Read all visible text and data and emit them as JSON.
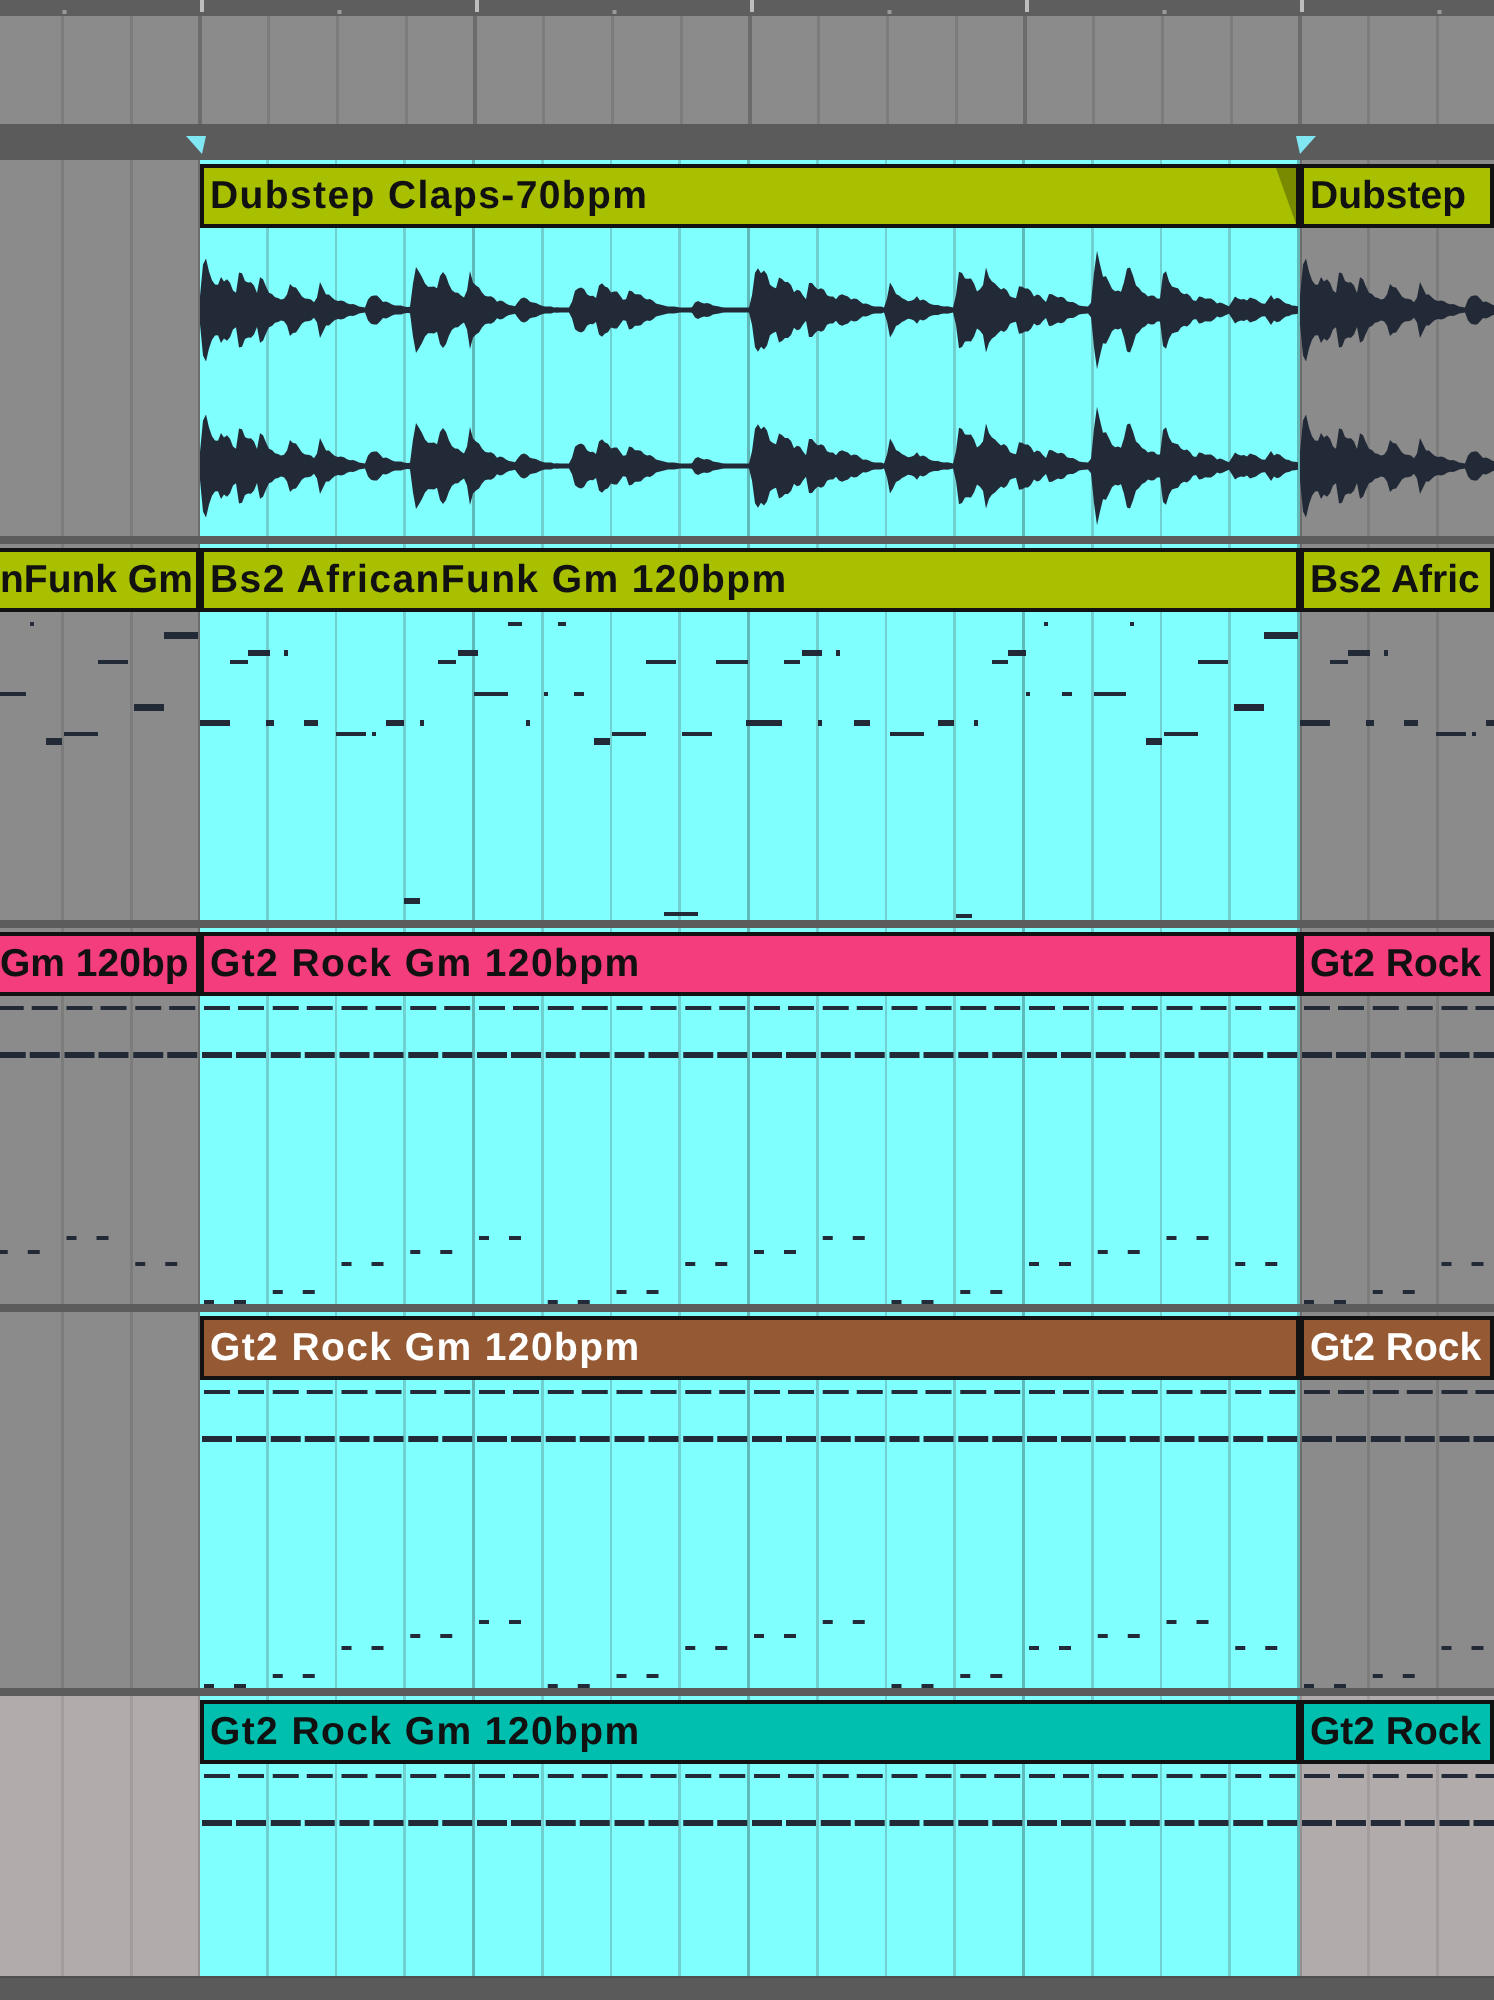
{
  "tracks": [
    {
      "selected": false
    },
    {
      "kind": "audio",
      "selected": false,
      "clips": [
        {
          "kind": "whole",
          "name": "Dubstep Claps-70bpm",
          "color": "#a8c000",
          "selected": true
        },
        {
          "kind": "head",
          "name": "Dubstep",
          "color": "#a8c000",
          "selected": false
        }
      ]
    },
    {
      "kind": "midi",
      "selected": false,
      "clips": [
        {
          "kind": "tail",
          "name": "nFunk Gm",
          "color": "#a8c000",
          "selected": false
        },
        {
          "kind": "whole",
          "name": "Bs2 AfricanFunk Gm 120bpm",
          "color": "#a8c000",
          "selected": true
        },
        {
          "kind": "head",
          "name": "Bs2 Afric",
          "color": "#a8c000",
          "selected": false
        }
      ]
    },
    {
      "kind": "midi",
      "selected": false,
      "clips": [
        {
          "kind": "tail",
          "name": "Gm 120bp",
          "color": "#f33d7d",
          "selected": false
        },
        {
          "kind": "whole",
          "name": "Gt2 Rock Gm 120bpm",
          "color": "#f33d7d",
          "selected": true
        },
        {
          "kind": "head",
          "name": "Gt2 Rock",
          "color": "#f33d7d",
          "selected": false
        }
      ]
    },
    {
      "kind": "midi",
      "selected": false,
      "clips": [
        {
          "kind": "whole",
          "name": "Gt2 Rock Gm 120bpm",
          "color": "#955a34",
          "selected": true
        },
        {
          "kind": "head",
          "name": "Gt2 Rock",
          "color": "#955a34",
          "selected": false
        }
      ]
    },
    {
      "kind": "midi",
      "selected": true,
      "clips": [
        {
          "kind": "whole",
          "name": "Gt2 Rock Gm 120bpm",
          "color": "#00bfae",
          "selected": true
        },
        {
          "kind": "head",
          "name": "Gt2 Rock",
          "color": "#00bfae",
          "selected": false
        }
      ]
    }
  ]
}
